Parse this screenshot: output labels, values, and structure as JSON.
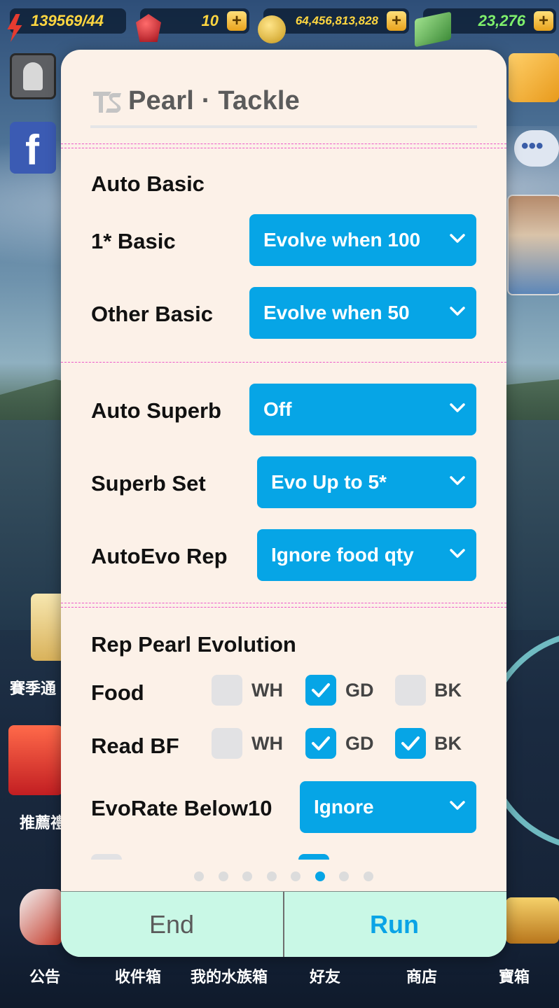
{
  "hud": {
    "energy": "139569/44",
    "gems": "10",
    "coins": "64,456,813,828",
    "cash": "23,276",
    "plus_symbol": "+"
  },
  "background_labels": {
    "season_pass": "賽季通",
    "recommend": "推薦禮",
    "nav": [
      "公告",
      "收件箱",
      "我的水族箱",
      "好友",
      "商店",
      "寶箱"
    ]
  },
  "panel": {
    "title": "Pearl · Tackle",
    "section1": {
      "heading": "Auto Basic",
      "rows": [
        {
          "label": "1* Basic",
          "value": "Evolve when 100"
        },
        {
          "label": "Other Basic",
          "value": "Evolve when 50"
        }
      ]
    },
    "section2": {
      "rows": [
        {
          "label": "Auto Superb",
          "value": "Off"
        },
        {
          "label": "Superb Set",
          "value": "Evo Up to 5*"
        },
        {
          "label": "AutoEvo Rep",
          "value": "Ignore food qty"
        }
      ]
    },
    "section3": {
      "heading": "Rep Pearl Evolution",
      "checkbox_rows": [
        {
          "label": "Food",
          "options": [
            {
              "name": "WH",
              "checked": false
            },
            {
              "name": "GD",
              "checked": true
            },
            {
              "name": "BK",
              "checked": false
            }
          ]
        },
        {
          "label": "Read BF",
          "options": [
            {
              "name": "WH",
              "checked": false
            },
            {
              "name": "GD",
              "checked": true
            },
            {
              "name": "BK",
              "checked": true
            }
          ]
        }
      ],
      "evorate": {
        "label": "EvoRate Below10",
        "value": "Ignore"
      }
    },
    "pager": {
      "total": 8,
      "active": 6
    },
    "footer": {
      "end_label": "End",
      "run_label": "Run"
    }
  },
  "colors": {
    "accent": "#06a5e6",
    "panel_bg": "#fcf1e8",
    "divider": "#ec58c8",
    "footer_bg": "#c9f8e6"
  }
}
